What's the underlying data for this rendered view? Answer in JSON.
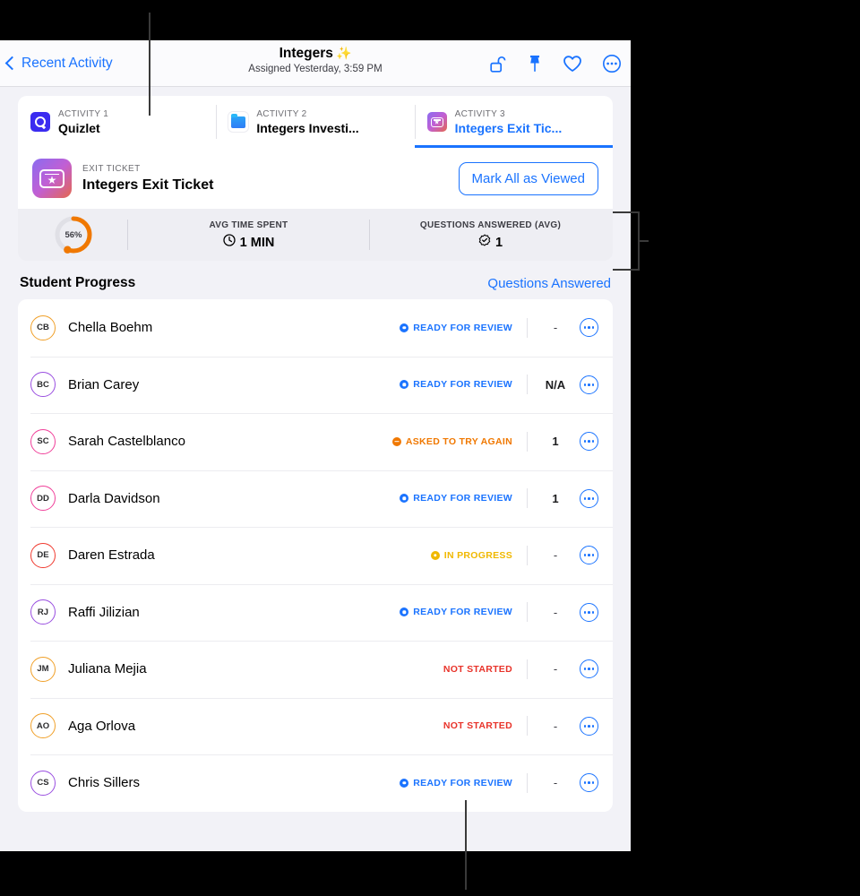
{
  "navbar": {
    "back_label": "Recent Activity",
    "title": "Integers",
    "title_sparkle": "✨",
    "subtitle": "Assigned Yesterday, 3:59 PM",
    "icons": [
      {
        "name": "unlock-icon",
        "label": "Unlock"
      },
      {
        "name": "pin-icon",
        "label": "Pin"
      },
      {
        "name": "heart-icon",
        "label": "Favorite"
      },
      {
        "name": "more-icon",
        "label": "More"
      }
    ]
  },
  "tabs": [
    {
      "kicker": "ACTIVITY 1",
      "name": "Quizlet",
      "icon": "quizlet-icon",
      "active": false
    },
    {
      "kicker": "ACTIVITY 2",
      "name": "Integers Investi...",
      "icon": "folder-icon",
      "active": false
    },
    {
      "kicker": "ACTIVITY 3",
      "name": "Integers Exit Tic...",
      "icon": "exit-ticket-icon",
      "active": true
    }
  ],
  "exit_header": {
    "kicker": "EXIT TICKET",
    "name": "Integers Exit Ticket",
    "icon": "exit-ticket-icon",
    "button_label": "Mark All as Viewed"
  },
  "stats": {
    "completion_percent": "56%",
    "completion_value": 56,
    "ring_color": "#f07800",
    "ring_track_color": "#e0e0e6",
    "items": [
      {
        "label": "AVG TIME SPENT",
        "value": "1 MIN",
        "icon": "clock-icon"
      },
      {
        "label": "QUESTIONS ANSWERED (AVG)",
        "value": "1",
        "icon": "check-badge-icon"
      }
    ]
  },
  "student_progress": {
    "title": "Student Progress",
    "link_label": "Questions Answered",
    "statuses": {
      "ready": {
        "label": "READY FOR REVIEW",
        "color": "#1a73ff"
      },
      "retry": {
        "label": "ASKED TO TRY AGAIN",
        "color": "#f07800"
      },
      "progress": {
        "label": "IN PROGRESS",
        "color": "#f0b800"
      },
      "not_started": {
        "label": "NOT STARTED",
        "color": "#e8332a"
      }
    },
    "rows": [
      {
        "initials": "CB",
        "name": "Chella Boehm",
        "avatar_color": "#f0a029",
        "status": "ready",
        "score": "-"
      },
      {
        "initials": "BC",
        "name": "Brian Carey",
        "avatar_color": "#9a4fe0",
        "status": "ready",
        "score": "N/A"
      },
      {
        "initials": "SC",
        "name": "Sarah Castelblanco",
        "avatar_color": "#f0409a",
        "status": "retry",
        "score": "1"
      },
      {
        "initials": "DD",
        "name": "Darla Davidson",
        "avatar_color": "#f0409a",
        "status": "ready",
        "score": "1"
      },
      {
        "initials": "DE",
        "name": "Daren Estrada",
        "avatar_color": "#f03a2f",
        "status": "progress",
        "score": "-"
      },
      {
        "initials": "RJ",
        "name": "Raffi Jilizian",
        "avatar_color": "#9a4fe0",
        "status": "ready",
        "score": "-"
      },
      {
        "initials": "JM",
        "name": "Juliana Mejia",
        "avatar_color": "#f0a029",
        "status": "not_started",
        "score": "-"
      },
      {
        "initials": "AO",
        "name": "Aga Orlova",
        "avatar_color": "#f0a029",
        "status": "not_started",
        "score": "-"
      },
      {
        "initials": "CS",
        "name": "Chris Sillers",
        "avatar_color": "#9a4fe0",
        "status": "ready",
        "score": "-"
      }
    ]
  }
}
